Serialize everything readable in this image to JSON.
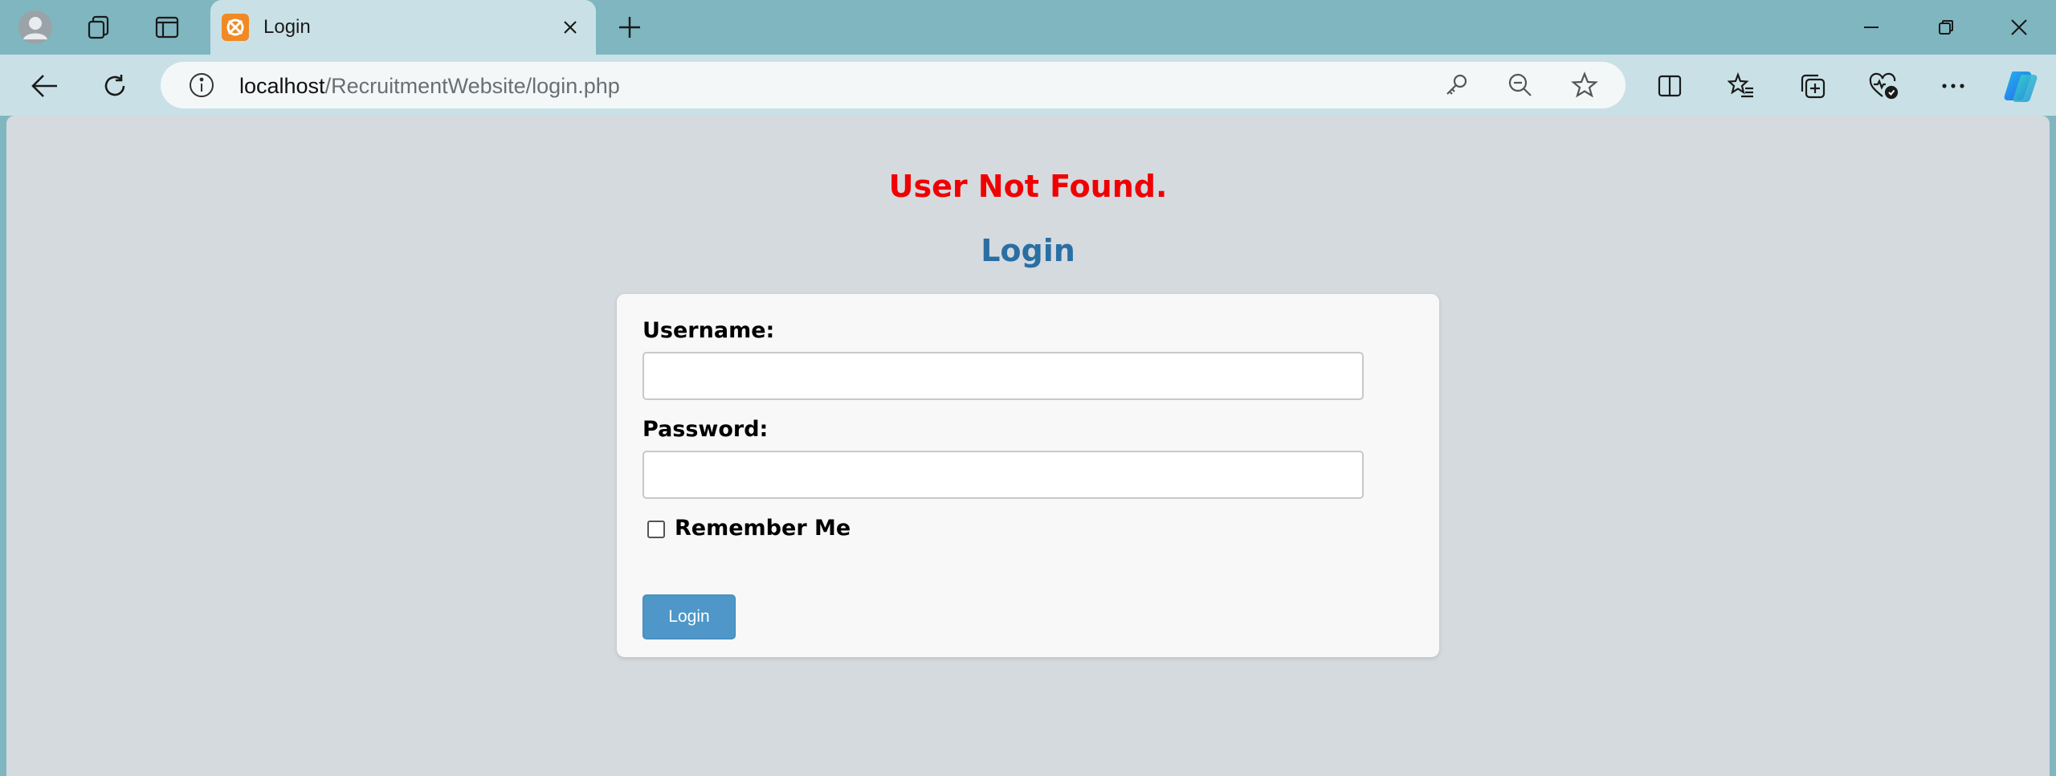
{
  "browser": {
    "tab": {
      "title": "Login"
    },
    "address_bar": {
      "host": "localhost",
      "path": "/RecruitmentWebsite/login.php"
    }
  },
  "page": {
    "error_message": "User Not Found.",
    "heading": "Login",
    "form": {
      "username_label": "Username:",
      "username_value": "",
      "password_label": "Password:",
      "password_value": "",
      "remember_label": "Remember Me",
      "remember_checked": false,
      "submit_label": "Login"
    }
  },
  "colors": {
    "error": "#f00000",
    "heading": "#2a6fa3",
    "button": "#4e97c8",
    "page_background": "#d5dadf",
    "browser_frame": "#7fb6c0"
  }
}
